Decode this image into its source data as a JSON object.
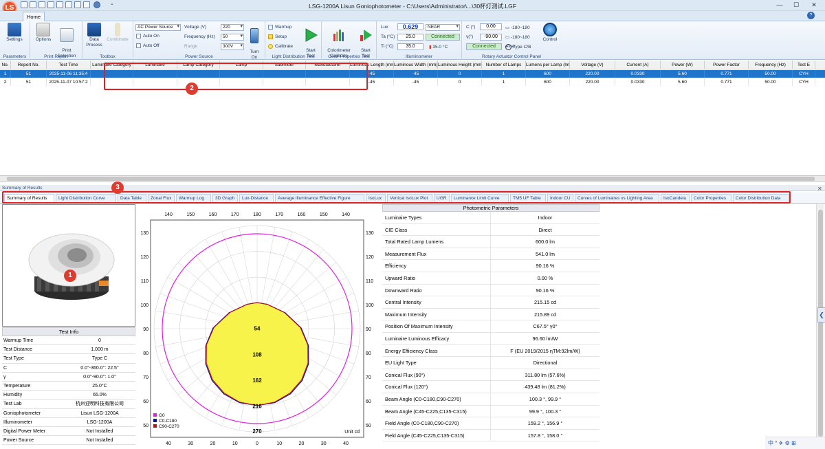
{
  "window": {
    "title": "LSG-1200A Lisun Goniophotometer  - C:\\Users\\Administrator\\...\\30杯灯测试.LGF",
    "logo_text": "LS",
    "quick_access_dropdown": "⌄",
    "min": "—",
    "max": "☐",
    "close": "✕"
  },
  "ribbon": {
    "home_tab": "Home",
    "help": "?",
    "groups": {
      "parameters": {
        "label": "Parameters",
        "settings": "Settings"
      },
      "print_report": {
        "label": "Print Report",
        "options": "Options",
        "print_selection": "Print\nSelection"
      },
      "toolbox": {
        "label": "Toolbox",
        "data_process": "Data\nProcess",
        "combinate": "Combinate"
      },
      "power_source": {
        "label": "Power Source",
        "source": "AC Power Source",
        "auto_on": "Auto On",
        "auto_off": "Auto Off",
        "voltage_label": "Voltage (V)",
        "voltage": "220",
        "frequency_label": "Frequency (Hz)",
        "frequency": "50",
        "range_label": "Range",
        "range": "300V",
        "turn_on": "Turn\nOn"
      },
      "light_distribution": {
        "label": "Light Distribution Test",
        "warmup": "Warmup",
        "setup": "Setup",
        "calibrate": "Calibrate",
        "start_test": "Start\nTest"
      },
      "color_properties": {
        "label": "Color Properties Test",
        "colorimeter_calibrate": "Colorimeter\nCalibrate",
        "start_test": "Start\nTest"
      },
      "illuminometer": {
        "label": "Illuminometer",
        "lux_label": "Lux",
        "lux": "0.629",
        "range": "NEAR",
        "ta_label": "Ta (°C)",
        "ta": "25.0",
        "status": "Connected",
        "ti_label": "Ti (°C)",
        "ti": "35.0",
        "temp": "35.0 °C"
      },
      "rotary": {
        "label": "Rotary Actuator Control Panel",
        "c_label": "C (°)",
        "c_val": "0.00",
        "c_range": "-180~180",
        "y_label": "γ(°)",
        "y_val": "-90.00",
        "y_range": "-180~180",
        "status": "Connected",
        "reset": "Reset",
        "type": "Type C/B",
        "control": "Control"
      }
    }
  },
  "grid": {
    "columns": [
      "No.",
      "Report No.",
      "Test Time",
      "Luminaire Category",
      "Luminaire",
      "Lamp Category",
      "Lamp",
      "Submitter",
      "Manufacturer",
      "Luminous Length (mm)",
      "Luminous Width (mm)",
      "Luminous Height (mm)",
      "Number of Lamps",
      "Lumens per Lamp (lm)",
      "Voltage (V)",
      "Current (A)",
      "Power (W)",
      "Power Factor",
      "Frequency (Hz)",
      "Test E"
    ],
    "rows": [
      [
        "1",
        "51",
        "2025-11-06 11:35:4",
        "",
        "",
        "",
        "",
        "",
        "",
        "-45",
        "-45",
        "0",
        "1",
        "600",
        "220.00",
        "0.0330",
        "5.60",
        "0.771",
        "50.00",
        "CYH"
      ],
      [
        "2",
        "51",
        "2025-11-07 10:57:2",
        "",
        "",
        "",
        "",
        "",
        "",
        "-45",
        "-45",
        "0",
        "1",
        "600",
        "220.00",
        "0.0330",
        "5.60",
        "0.771",
        "50.00",
        "CYH"
      ]
    ]
  },
  "summary_bar": "Summary of Results",
  "result_tabs": [
    "Summary of Results",
    "Light Distribution Curve",
    "Data Table",
    "Zonal Flux",
    "Warmup Log",
    "3D Graph",
    "Lux-Distance",
    "Average Illuminance Effective Figure",
    "IsoLux",
    "Vertical IsoLux Plot",
    "UGR",
    "Luminance Limit Curve",
    "TM5 UF Table",
    "Indoor CU",
    "Curves of Luminaires vs Lighting Area",
    "IsoCandela",
    "Color Properties",
    "Color Distribution Data"
  ],
  "test_info": {
    "title": "Test Info",
    "rows": [
      [
        "Warmup Time",
        "0"
      ],
      [
        "Test Distance",
        "1.000 m"
      ],
      [
        "Test Type",
        "Type C"
      ],
      [
        "C",
        "0.0°-360.0°: 22.5°"
      ],
      [
        "γ",
        "0.0°-90.0°: 1.0°"
      ],
      [
        "Temperature",
        "25.0°C"
      ],
      [
        "Humidity",
        "65.0%"
      ],
      [
        "Test Lab",
        "杭州迎明科技有限公司"
      ],
      [
        "Goniophotometer",
        "Lisun LSG-1200A"
      ],
      [
        "Illuminometer",
        "LSG-1200A"
      ],
      [
        "Digital Power Meter",
        "Not Installed"
      ],
      [
        "Power Source",
        "Not Installed"
      ]
    ]
  },
  "photometric": {
    "title": "Photometric Parameters",
    "rows": [
      [
        "Luminaire Types",
        "Indoor"
      ],
      [
        "CIE Class",
        "Direct"
      ],
      [
        "Total Rated Lamp Lumens",
        "600.0 lm"
      ],
      [
        "Measurement Flux",
        "541.0 lm"
      ],
      [
        "Efficiency",
        "90.16 %"
      ],
      [
        "Upward Ratio",
        "0.00 %"
      ],
      [
        "Downward Ratio",
        "90.16 %"
      ],
      [
        "Central Intensity",
        "215.15 cd"
      ],
      [
        "Maximum Intensity",
        "215.89 cd"
      ],
      [
        "Position Of Maximum Intensity",
        "C67.5° γ0°"
      ],
      [
        "Luminaire Luminous Efficacy",
        "96.60 lm/W"
      ],
      [
        "Energy Efficiency Class",
        "F (EU 2019/2015 ηTM:92lm/W)"
      ],
      [
        "EU Light Type",
        "Directional"
      ],
      [
        "Conical Flux (90°)",
        "311.80 lm (57.6%)"
      ],
      [
        "Conical Flux (120°)",
        "439.48 lm (81.2%)"
      ],
      [
        "Beam Angle (C0-C180,C90-C270)",
        "100.3 °, 99.9 °"
      ],
      [
        "Beam Angle (C45-C225,C135-C315)",
        "99.9 °, 100.3 °"
      ],
      [
        "Field Angle (C0-C180,C90-C270)",
        "159.2 °, 156.9 °"
      ],
      [
        "Field Angle (C45-C225,C135-C315)",
        "157.8 °, 158.0 °"
      ]
    ]
  },
  "chart_data": {
    "type": "polar",
    "title": "",
    "unit": "Unit cd",
    "radial_labels": [
      "54",
      "108",
      "162",
      "216"
    ],
    "radial_max": 216,
    "bottom_label": "270",
    "top_ticks": [
      "140",
      "150",
      "160",
      "170",
      "180",
      "170",
      "160",
      "150",
      "140"
    ],
    "bottom_ticks": [
      "40",
      "30",
      "20",
      "10",
      "0",
      "10",
      "20",
      "30",
      "40"
    ],
    "left_ticks": [
      "130",
      "120",
      "110",
      "100",
      "90",
      "80",
      "70",
      "60",
      "50"
    ],
    "right_ticks": [
      "130",
      "120",
      "110",
      "100",
      "90",
      "80",
      "70",
      "60",
      "50"
    ],
    "legend": [
      {
        "name": "G0",
        "color": "#e020e0"
      },
      {
        "name": "C0-C180",
        "color": "#1010a0"
      },
      {
        "name": "C90-C270",
        "color": "#c01010"
      }
    ],
    "series": [
      {
        "name": "C0-C180",
        "angles_deg": [
          0,
          10,
          20,
          30,
          40,
          50,
          60,
          70,
          80,
          90
        ],
        "values": [
          215,
          212,
          203,
          188,
          167,
          140,
          106,
          62,
          22,
          0
        ]
      },
      {
        "name": "C90-C270",
        "angles_deg": [
          0,
          10,
          20,
          30,
          40,
          50,
          60,
          70,
          80,
          90
        ],
        "values": [
          215,
          211,
          201,
          186,
          165,
          138,
          104,
          60,
          21,
          0
        ]
      }
    ],
    "fill_color": "#f7f34a"
  },
  "annotations": [
    "1",
    "2",
    "3"
  ],
  "tray": [
    "中",
    "°",
    "✈",
    "⚙",
    "⊞"
  ],
  "side_arrow": "❮",
  "close_panel": "✕"
}
